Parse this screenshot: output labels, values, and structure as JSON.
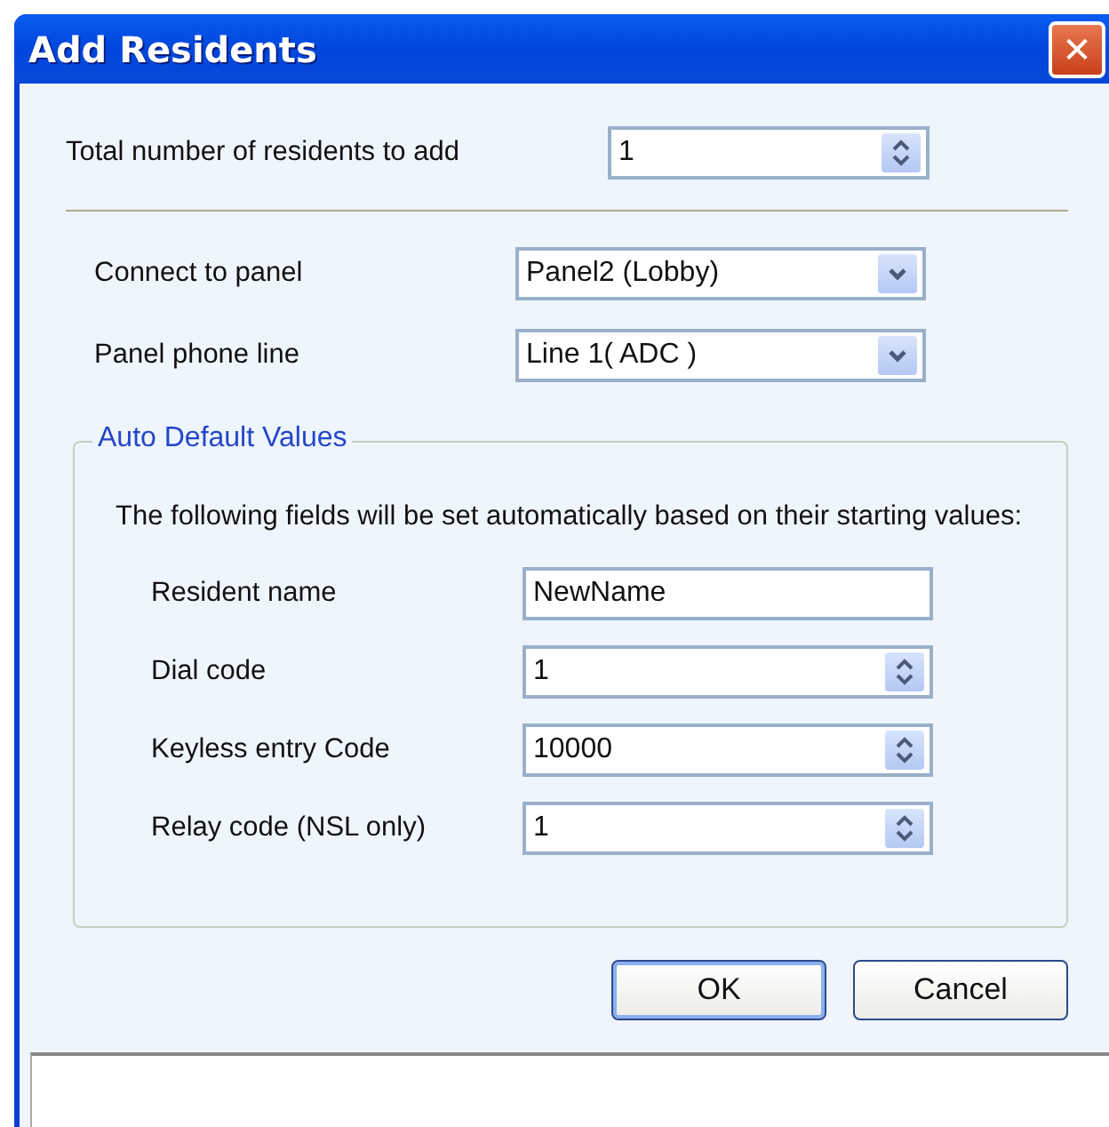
{
  "window": {
    "title": "Add Residents",
    "close": "✕"
  },
  "total": {
    "label": "Total number of residents to add",
    "kind": "spin",
    "value": "1"
  },
  "connection": [
    {
      "label": "Connect to panel",
      "kind": "combo",
      "value": "Panel2 (Lobby)"
    },
    {
      "label": "Panel phone line",
      "kind": "combo",
      "value": "Line 1( ADC )"
    }
  ],
  "group": {
    "title": "Auto Default Values",
    "description": "The following fields will be set automatically based on their starting values:",
    "fields": [
      {
        "label": "Resident name",
        "kind": "text",
        "value": "NewName"
      },
      {
        "label": "Dial code",
        "kind": "spin",
        "value": "1"
      },
      {
        "label": "Keyless entry Code",
        "kind": "spin",
        "value": "10000"
      },
      {
        "label": "Relay code (NSL only)",
        "kind": "spin",
        "value": "1"
      }
    ]
  },
  "buttons": [
    {
      "label": "OK",
      "default": true
    },
    {
      "label": "Cancel",
      "default": false
    }
  ]
}
